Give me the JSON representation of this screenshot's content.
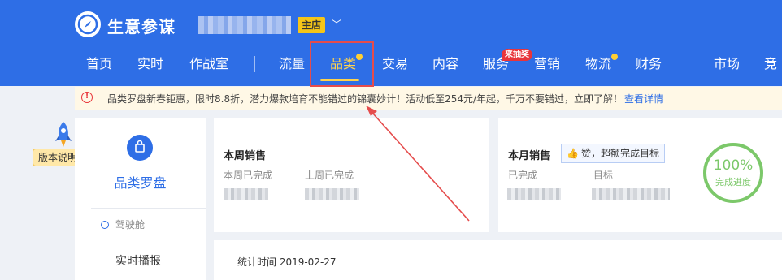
{
  "header": {
    "brand": "生意参谋",
    "shop_badge": "主店",
    "caret": "﹀",
    "nav": [
      "首页",
      "实时",
      "作战室",
      "流量",
      "品类",
      "交易",
      "内容",
      "服务",
      "营销",
      "物流",
      "财务",
      "市场",
      "竞"
    ],
    "active_nav": "品类",
    "hot_badge": "来抽奖"
  },
  "notice": {
    "icon": "alert-icon",
    "text": "品类罗盘新春钜惠，限时8.8折，潜力爆款培育不能错过的锦囊妙计！活动低至254元/年起，千万不要错过，立即了解！",
    "link": "查看详情"
  },
  "version_badge": "版本说明",
  "sidebar": {
    "title": "品类罗盘",
    "section": "驾驶舱",
    "item": "实时播报"
  },
  "weekly_card": {
    "title": "本周销售",
    "label1": "本周已完成",
    "label2": "上周已完成"
  },
  "monthly_card": {
    "title": "本月销售",
    "praise": "赞，超额完成目标",
    "label1": "已完成",
    "label2": "目标",
    "progress_text": "100%",
    "progress_value": 1.0,
    "progress_label": "完成进度"
  },
  "stat_time": "统计时间 2019-02-27",
  "colors": {
    "header_bg": "#2e6ee6",
    "active": "#ffd34d",
    "highlight": "#e54c4c",
    "progress": "#7cc86a"
  }
}
